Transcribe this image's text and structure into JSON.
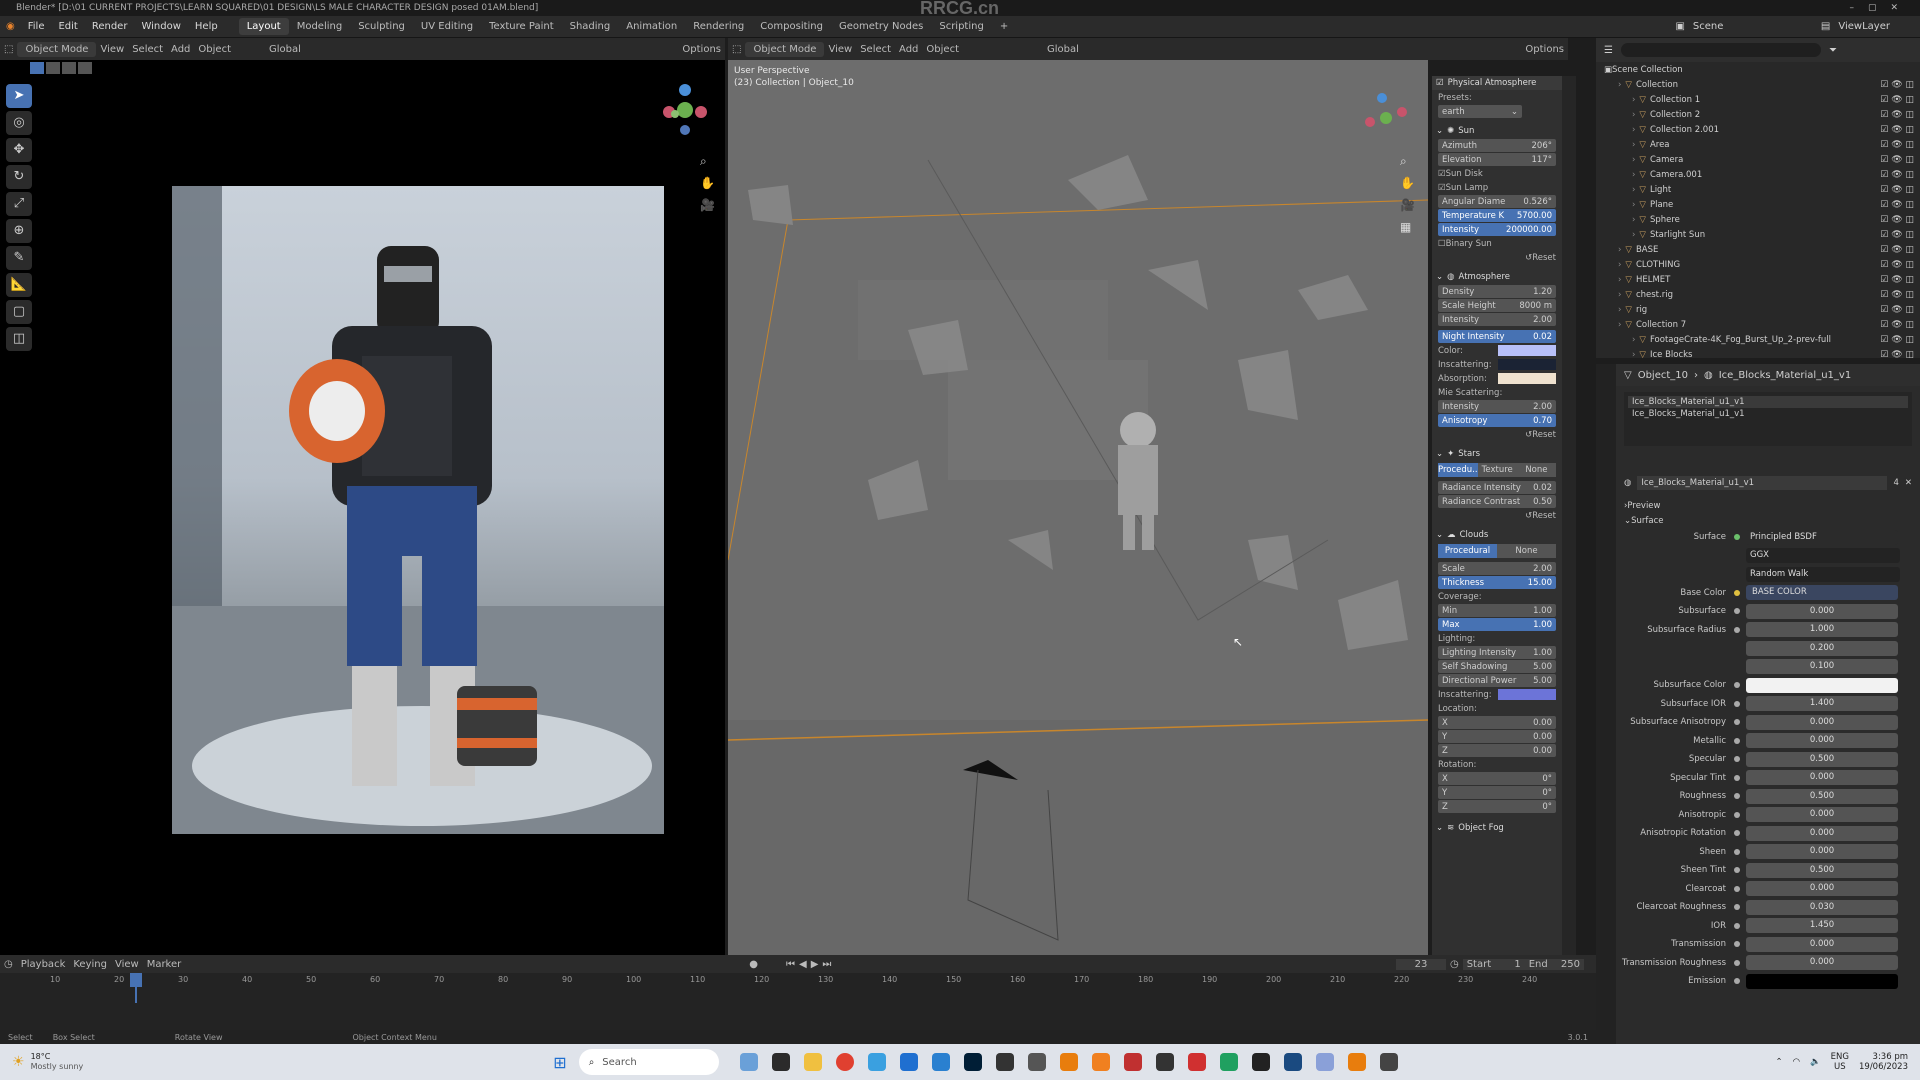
{
  "title": "Blender* [D:\\01 CURRENT PROJECTS\\LEARN SQUARED\\01 DESIGN\\LS MALE CHARACTER DESIGN posed 01AM.blend]",
  "watermark": "RRCG.cn",
  "menu": [
    "File",
    "Edit",
    "Render",
    "Window",
    "Help"
  ],
  "workspaces": [
    "Layout",
    "Modeling",
    "Sculpting",
    "UV Editing",
    "Texture Paint",
    "Shading",
    "Animation",
    "Rendering",
    "Compositing",
    "Geometry Nodes",
    "Scripting"
  ],
  "scene": "Scene",
  "view_layer": "ViewLayer",
  "left_header": {
    "mode": "Object Mode",
    "items": [
      "View",
      "Select",
      "Add",
      "Object"
    ],
    "transform": "Global",
    "options": "Options"
  },
  "vp_header": {
    "mode": "Object Mode",
    "items": [
      "View",
      "Select",
      "Add",
      "Object"
    ],
    "transform": "Global",
    "options": "Options"
  },
  "viewport": {
    "title": "User Perspective",
    "sub": "(23) Collection | Object_10"
  },
  "npanel": {
    "physical": "Physical Atmosphere",
    "presets_label": "Presets:",
    "preset": "earth",
    "sun": "Sun",
    "sun_rows": [
      [
        "Azimuth",
        "206°"
      ],
      [
        "Elevation",
        "117°"
      ]
    ],
    "sun_disk": "Sun Disk",
    "sun_lamp": "Sun Lamp",
    "sun_rows2": [
      [
        "Angular Diame",
        "0.526°"
      ],
      [
        "Temperature K",
        "5700.00"
      ],
      [
        "Intensity",
        "200000.00"
      ]
    ],
    "binary": "Binary Sun",
    "reset": "Reset",
    "atmosphere": "Atmosphere",
    "atm_rows": [
      [
        "Density",
        "1.20"
      ],
      [
        "Scale Height",
        "8000 m"
      ],
      [
        "Intensity",
        "2.00"
      ],
      [
        "Night Intensity",
        "0.02"
      ]
    ],
    "color": "Color:",
    "inscattering": "Inscattering:",
    "absorption": "Absorption:",
    "mie": "Mie Scattering:",
    "mie_rows": [
      [
        "Intensity",
        "2.00"
      ],
      [
        "Anisotropy",
        "0.70"
      ]
    ],
    "stars": "Stars",
    "stars_tabs": [
      "Procedu..",
      "Texture",
      "None"
    ],
    "stars_rows": [
      [
        "Radiance Intensity",
        "0.02"
      ],
      [
        "Radiance Contrast",
        "0.50"
      ]
    ],
    "clouds": "Clouds",
    "clouds_tabs": [
      "Procedural",
      "None"
    ],
    "cloud_rows": [
      [
        "Scale",
        "2.00"
      ],
      [
        "Thickness",
        "15.00"
      ]
    ],
    "coverage": "Coverage:",
    "cov_rows": [
      [
        "Min",
        "1.00"
      ],
      [
        "Max",
        "1.00"
      ]
    ],
    "lighting": "Lighting:",
    "light_rows": [
      [
        "Lighting Intensity",
        "1.00"
      ],
      [
        "Self Shadowing",
        "5.00"
      ],
      [
        "Directional Power",
        "5.00"
      ]
    ],
    "location": "Location:",
    "loc_rows": [
      [
        "X",
        "0.00"
      ],
      [
        "Y",
        "0.00"
      ],
      [
        "Z",
        "0.00"
      ]
    ],
    "rotation": "Rotation:",
    "rot_rows": [
      [
        "X",
        "0°"
      ],
      [
        "Y",
        "0°"
      ],
      [
        "Z",
        "0°"
      ]
    ],
    "fog": "Object Fog"
  },
  "outliner": {
    "root": "Scene Collection",
    "rows": [
      {
        "name": "Collection",
        "d": 1
      },
      {
        "name": "Collection 1",
        "d": 2
      },
      {
        "name": "Collection 2",
        "d": 2
      },
      {
        "name": "Collection 2.001",
        "d": 2
      },
      {
        "name": "Area",
        "d": 2
      },
      {
        "name": "Camera",
        "d": 2
      },
      {
        "name": "Camera.001",
        "d": 2
      },
      {
        "name": "Light",
        "d": 2
      },
      {
        "name": "Plane",
        "d": 2
      },
      {
        "name": "Sphere",
        "d": 2
      },
      {
        "name": "Starlight Sun",
        "d": 2
      },
      {
        "name": "BASE",
        "d": 1
      },
      {
        "name": "CLOTHING",
        "d": 1
      },
      {
        "name": "HELMET",
        "d": 1
      },
      {
        "name": "chest.rig",
        "d": 1
      },
      {
        "name": "rig",
        "d": 1
      },
      {
        "name": "Collection 7",
        "d": 1
      },
      {
        "name": "FootageCrate-4K_Fog_Burst_Up_2-prev-full",
        "d": 2
      },
      {
        "name": "Ice Blocks",
        "d": 2
      }
    ]
  },
  "material": {
    "breadcrumb_obj": "Object_10",
    "breadcrumb_mat": "Ice_Blocks_Material_u1_v1",
    "slots": [
      "Ice_Blocks_Material_u1_v1",
      "Ice_Blocks_Material_u1_v1"
    ],
    "name": "Ice_Blocks_Material_u1_v1",
    "users": "4",
    "preview": "Preview",
    "surface": "Surface",
    "surface_label": "Surface",
    "shader": "Principled BSDF",
    "dist": "GGX",
    "sss": "Random Walk",
    "rows": [
      [
        "Base Color",
        "BASE COLOR",
        0
      ],
      [
        "Subsurface",
        "0.000",
        0
      ],
      [
        "Subsurface Radius",
        "1.000",
        0
      ],
      [
        "",
        "0.200",
        0
      ],
      [
        "",
        "0.100",
        0
      ],
      [
        "Subsurface Color",
        "",
        0
      ],
      [
        "Subsurface IOR",
        "1.400",
        0.1
      ],
      [
        "Subsurface Anisotropy",
        "0.000",
        0
      ],
      [
        "Metallic",
        "0.000",
        0
      ],
      [
        "Specular",
        "0.500",
        0.5
      ],
      [
        "Specular Tint",
        "0.000",
        0
      ],
      [
        "Roughness",
        "0.500",
        0.5
      ],
      [
        "Anisotropic",
        "0.000",
        0
      ],
      [
        "Anisotropic Rotation",
        "0.000",
        0
      ],
      [
        "Sheen",
        "0.000",
        0
      ],
      [
        "Sheen Tint",
        "0.500",
        0.5
      ],
      [
        "Clearcoat",
        "0.000",
        0
      ],
      [
        "Clearcoat Roughness",
        "0.030",
        0.03
      ],
      [
        "IOR",
        "1.450",
        0
      ],
      [
        "Transmission",
        "0.000",
        0
      ],
      [
        "Transmission Roughness",
        "0.000",
        0
      ],
      [
        "Emission",
        "",
        0
      ]
    ]
  },
  "timeline": {
    "items": [
      "Playback",
      "Keying",
      "View",
      "Marker"
    ],
    "frame": "23",
    "start_label": "Start",
    "start": "1",
    "end_label": "End",
    "end": "250",
    "ticks": [
      "10",
      "20",
      "30",
      "40",
      "50",
      "60",
      "70",
      "80",
      "90",
      "100",
      "110",
      "120",
      "130",
      "140",
      "150",
      "160",
      "170",
      "180",
      "190",
      "200",
      "210",
      "220",
      "230",
      "240"
    ],
    "current": "23"
  },
  "status": {
    "select": "Select",
    "box": "Box Select",
    "rotate": "Rotate View",
    "ctx": "Object Context Menu",
    "ver": "3.0.1"
  },
  "taskbar": {
    "weather_temp": "18°C",
    "weather_desc": "Mostly sunny",
    "search": "Search",
    "lang": "ENG",
    "region": "US",
    "time": "3:36 pm",
    "date": "19/06/2023"
  }
}
